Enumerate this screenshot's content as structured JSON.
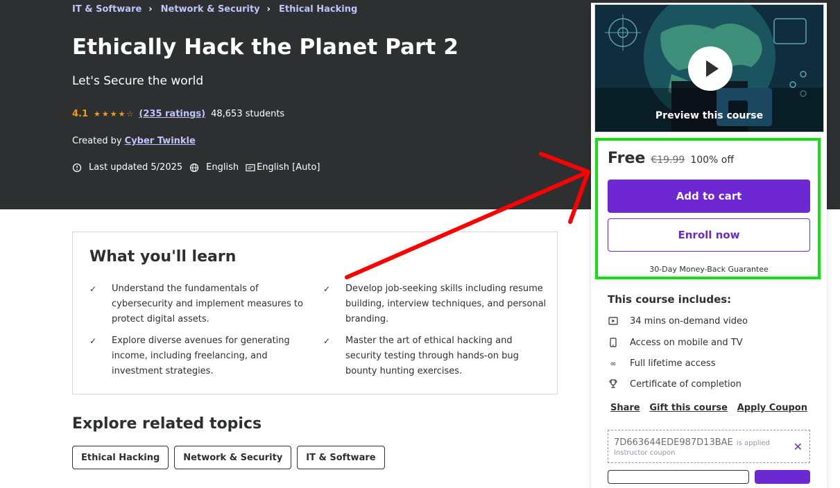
{
  "breadcrumbs": [
    "IT & Software",
    "Network & Security",
    "Ethical Hacking"
  ],
  "course": {
    "title": "Ethically Hack the Planet Part 2",
    "subtitle": "Let's Secure the world",
    "rating": "4.1",
    "ratings_count": "(235 ratings)",
    "students": "48,653 students",
    "created_by_label": "Created by",
    "author": "Cyber Twinkle",
    "last_updated": "Last updated 5/2025",
    "language": "English",
    "captions": "English [Auto]"
  },
  "learn": {
    "title": "What you'll learn",
    "items": [
      "Understand the fundamentals of cybersecurity and implement measures to protect digital assets.",
      "Develop job-seeking skills including resume building, interview techniques, and personal branding.",
      "Explore diverse avenues for generating income, including freelancing, and investment strategies.",
      "Master the art of ethical hacking and security testing through hands-on bug bounty hunting exercises."
    ]
  },
  "explore": {
    "title": "Explore related topics",
    "tags": [
      "Ethical Hacking",
      "Network & Security",
      "IT & Software"
    ]
  },
  "sidebar": {
    "preview_label": "Preview this course",
    "price": "Free",
    "original_price": "€19.99",
    "discount": "100% off",
    "add_to_cart": "Add to cart",
    "enroll_now": "Enroll now",
    "guarantee": "30-Day Money-Back Guarantee",
    "includes_title": "This course includes:",
    "includes": [
      {
        "icon": "video-icon",
        "label": "34 mins on-demand video"
      },
      {
        "icon": "mobile-icon",
        "label": "Access on mobile and TV"
      },
      {
        "icon": "infinity-icon",
        "label": "Full lifetime access"
      },
      {
        "icon": "trophy-icon",
        "label": "Certificate of completion"
      }
    ],
    "links": {
      "share": "Share",
      "gift": "Gift this course",
      "coupon": "Apply Coupon"
    },
    "coupon": {
      "code": "7D663644EDE987D13BAE",
      "applied": "is applied",
      "type": "Instructor coupon"
    }
  },
  "colors": {
    "hero_bg": "#2d2f31",
    "accent_purple": "#6d28d2",
    "star": "#f69c08",
    "link_light": "#c0c4fc",
    "annotation_green": "#12e012",
    "annotation_red": "#ff0000"
  }
}
